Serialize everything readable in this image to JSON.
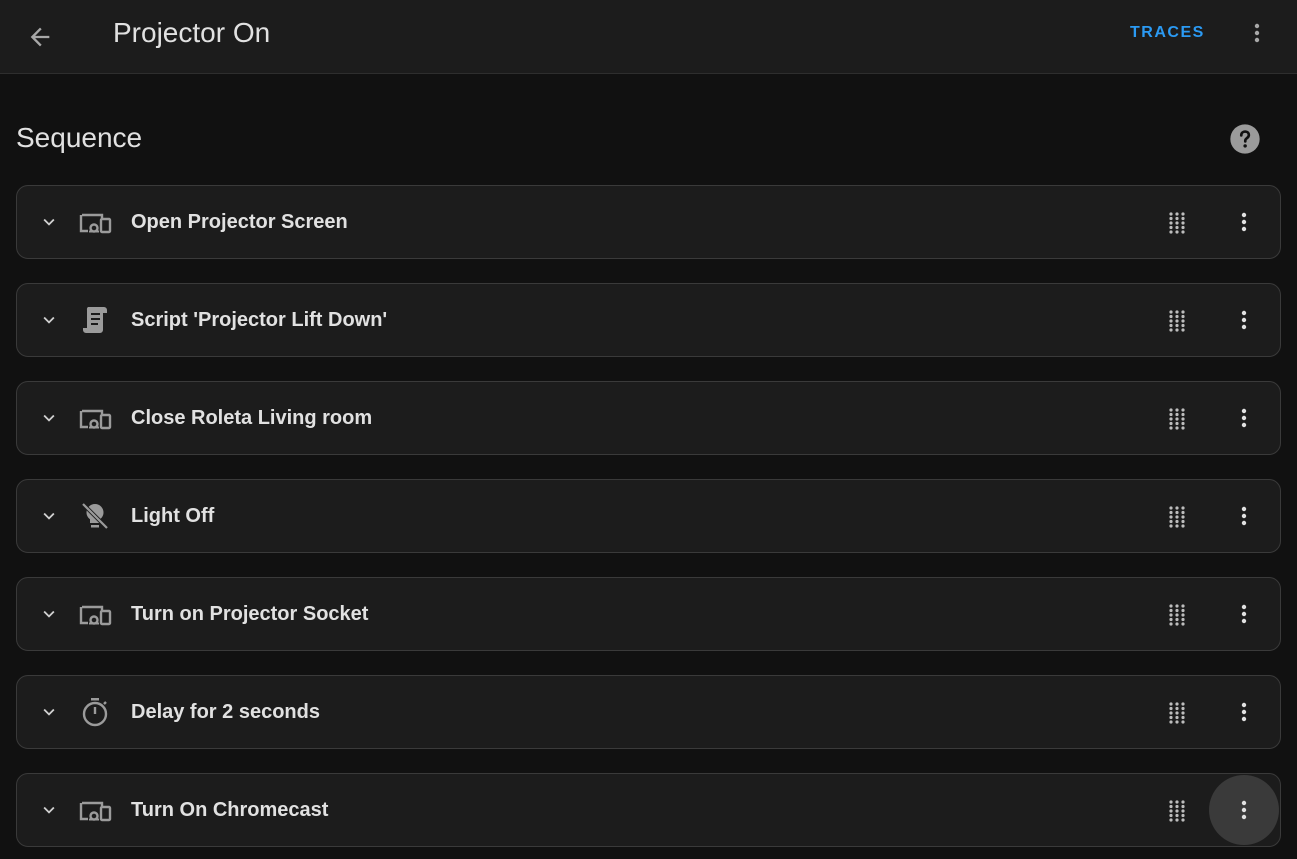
{
  "header": {
    "title": "Projector On",
    "traces_label": "TRACES",
    "back_icon": "arrow-left-icon",
    "more_icon": "dots-vertical-icon"
  },
  "section": {
    "title": "Sequence",
    "help_icon": "help-circle-icon"
  },
  "actions": [
    {
      "label": "Open Projector Screen",
      "icon": "devices-icon"
    },
    {
      "label": "Script 'Projector Lift Down'",
      "icon": "script-icon"
    },
    {
      "label": "Close Roleta Living room",
      "icon": "devices-icon"
    },
    {
      "label": "Light Off",
      "icon": "lightbulb-off-icon"
    },
    {
      "label": "Turn on Projector Socket",
      "icon": "devices-icon"
    },
    {
      "label": "Delay for 2 seconds",
      "icon": "timer-icon"
    },
    {
      "label": "Turn On Chromecast",
      "icon": "devices-icon"
    }
  ],
  "colors": {
    "accent": "#2b9af3",
    "background": "#111111",
    "card": "#1c1c1c",
    "text": "#e1e1e1",
    "icon": "#9b9b9b"
  }
}
